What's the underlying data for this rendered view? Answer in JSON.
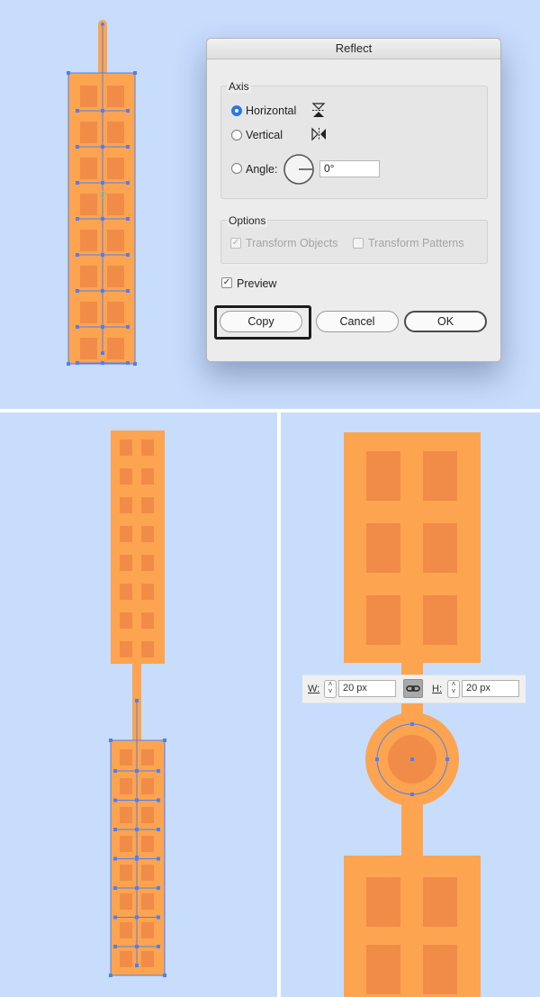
{
  "dialog": {
    "title": "Reflect",
    "axis": {
      "legend": "Axis",
      "options": [
        {
          "label": "Horizontal",
          "selected": true,
          "icon": "reflect-horizontal-icon"
        },
        {
          "label": "Vertical",
          "selected": false,
          "icon": "reflect-vertical-icon"
        },
        {
          "label": "Angle:",
          "selected": false,
          "icon": "angle-dial-icon"
        }
      ],
      "angle_value": "0°"
    },
    "options": {
      "legend": "Options",
      "transform_objects": {
        "label": "Transform Objects",
        "checked": true,
        "enabled": false
      },
      "transform_patterns": {
        "label": "Transform Patterns",
        "checked": false,
        "enabled": false
      }
    },
    "preview": {
      "label": "Preview",
      "checked": true
    },
    "buttons": {
      "copy": "Copy",
      "cancel": "Cancel",
      "ok": "OK"
    }
  },
  "transform_bar": {
    "width_label": "W:",
    "width_value": "20 px",
    "height_label": "H:",
    "height_value": "20 px",
    "constrain_icon": "link-icon"
  },
  "colors": {
    "canvas": "#c8dcfc",
    "building": "#fca450",
    "window": "#f18c48",
    "selection": "#4f7ff0"
  }
}
